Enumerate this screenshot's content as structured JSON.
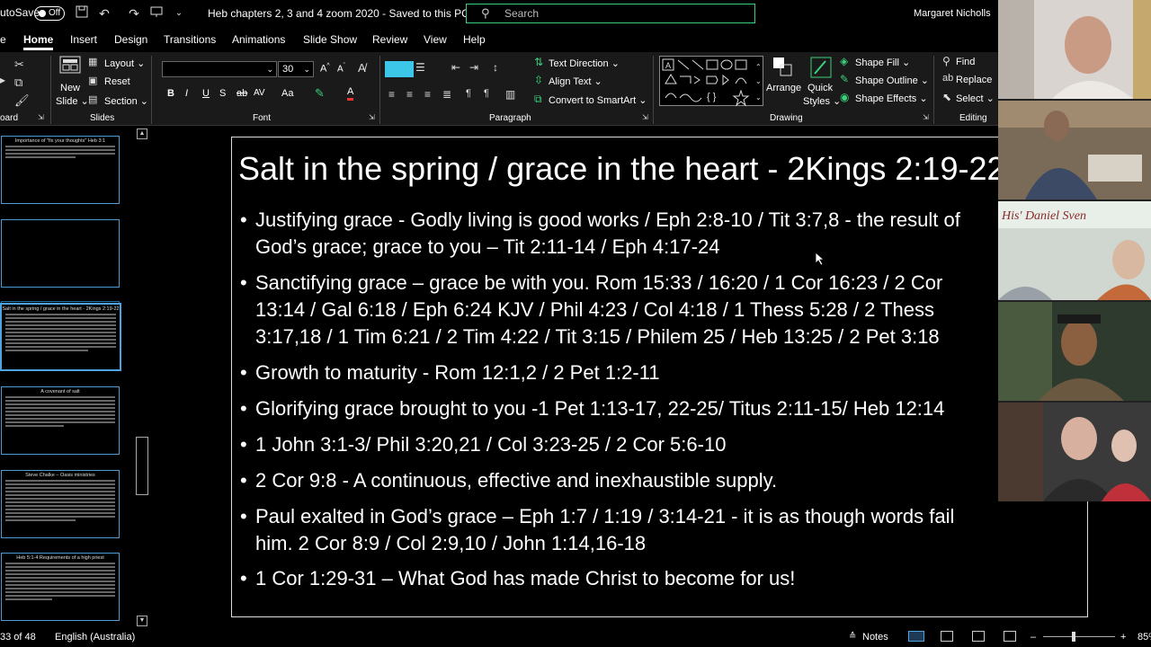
{
  "titlebar": {
    "autosave_label": "utoSave",
    "autosave_state": "Off",
    "doc_title": "Heb chapters 2, 3 and 4 zoom 2020  -  Saved to this PC  ⌄",
    "search_placeholder": "Search",
    "user_name": "Margaret Nicholls"
  },
  "menu": {
    "tabs": [
      "Home",
      "Insert",
      "Design",
      "Transitions",
      "Animations",
      "Slide Show",
      "Review",
      "View",
      "Help"
    ],
    "active": "Home"
  },
  "ribbon": {
    "clipboard_label": "oard",
    "slides": {
      "new_slide": "New",
      "new_slide2": "Slide ⌄",
      "layout": "Layout ⌄",
      "reset": "Reset",
      "section": "Section ⌄",
      "label": "Slides"
    },
    "font": {
      "font_name": "",
      "font_size": "30",
      "label": "Font",
      "bold": "B",
      "italic": "I",
      "underline": "U",
      "strike": "S",
      "spacing": "AV",
      "case": "Aa"
    },
    "paragraph": {
      "text_direction": "Text Direction ⌄",
      "align_text": "Align Text ⌄",
      "smartart": "Convert to SmartArt ⌄",
      "label": "Paragraph"
    },
    "drawing": {
      "arrange": "Arrange",
      "quick_styles": "Quick",
      "quick_styles2": "Styles ⌄",
      "shape_fill": "Shape Fill ⌄",
      "shape_outline": "Shape Outline ⌄",
      "shape_effects": "Shape Effects ⌄",
      "label": "Drawing"
    },
    "editing": {
      "find": "Find",
      "replace": "Replace",
      "select": "Select ⌄",
      "label": "Editing"
    }
  },
  "thumbnails": [
    {
      "title": "Importance of \"fix your thoughts\" Heb 3:1",
      "lines": 4,
      "selected": false
    },
    {
      "title": "",
      "lines": 0,
      "selected": false
    },
    {
      "title": "",
      "lines": 0,
      "selected": false
    },
    {
      "title": "Salt in the spring / grace in the heart - 2Kings 2:19-22",
      "lines": 11,
      "selected": true
    },
    {
      "title": "A covenant of salt",
      "lines": 9,
      "selected": false
    },
    {
      "title": "Steve Chalke – Oasis ministries",
      "lines": 12,
      "selected": false
    },
    {
      "title": "Heb 5:1-4 Requirements of a high priest",
      "lines": 11,
      "selected": false
    }
  ],
  "slide": {
    "title": "Salt in the spring / grace in the heart - 2Kings 2:19-22",
    "bullets": [
      [
        "Justifying grace - Godly living is good works / Eph 2:8-10 / Tit 3:7,8 - the result of",
        "God’s grace; grace to you – Tit 2:11-14 / Eph 4:17-24"
      ],
      [
        "Sanctifying grace – grace be with you. Rom 15:33 / 16:20 / 1 Cor 16:23 / 2 Cor",
        "13:14 / Gal 6:18 / Eph 6:24 KJV / Phil 4:23 / Col 4:18 / 1 Thess 5:28 / 2 Thess",
        "3:17,18 / 1 Tim 6:21 / 2 Tim 4:22 / Tit 3:15 / Philem 25 / Heb 13:25 / 2 Pet 3:18"
      ],
      [
        "Growth to maturity - Rom 12:1,2 / 2 Pet 1:2-11"
      ],
      [
        "Glorifying grace brought to you -1 Pet 1:13-17, 22-25/ Titus 2:11-15/ Heb 12:14"
      ],
      [
        "1 John 3:1-3/ Phil 3:20,21 / Col 3:23-25 / 2 Cor 5:6-10"
      ],
      [
        "2 Cor 9:8 - A continuous, effective and inexhaustible supply."
      ],
      [
        "Paul exalted in God’s grace – Eph 1:7 / 1:19 / 3:14-21  - it is as though words fail",
        "him. 2 Cor 8:9 / Col 2:9,10 / John 1:14,16-18"
      ],
      [
        "1 Cor 1:29-31 – What God has made Christ to become for us!"
      ]
    ]
  },
  "video": {
    "tiles": [
      {
        "bg": "#d9d4cf",
        "person": "#b48c78"
      },
      {
        "bg": "#6a5a4a",
        "person": "#3c4a66"
      },
      {
        "bg": "#cfd7d0",
        "person": "#c46a3a"
      },
      {
        "bg": "#2f3a2e",
        "person": "#6b5840"
      },
      {
        "bg": "#3a3a3a",
        "person": "#8a7a70"
      }
    ]
  },
  "status": {
    "slide_count": "33 of 48",
    "language": "English (Australia)",
    "notes": "Notes",
    "zoom": "85%"
  },
  "colors": {
    "accent_green": "#3bd17b",
    "selection_blue": "#4fa3e0"
  }
}
